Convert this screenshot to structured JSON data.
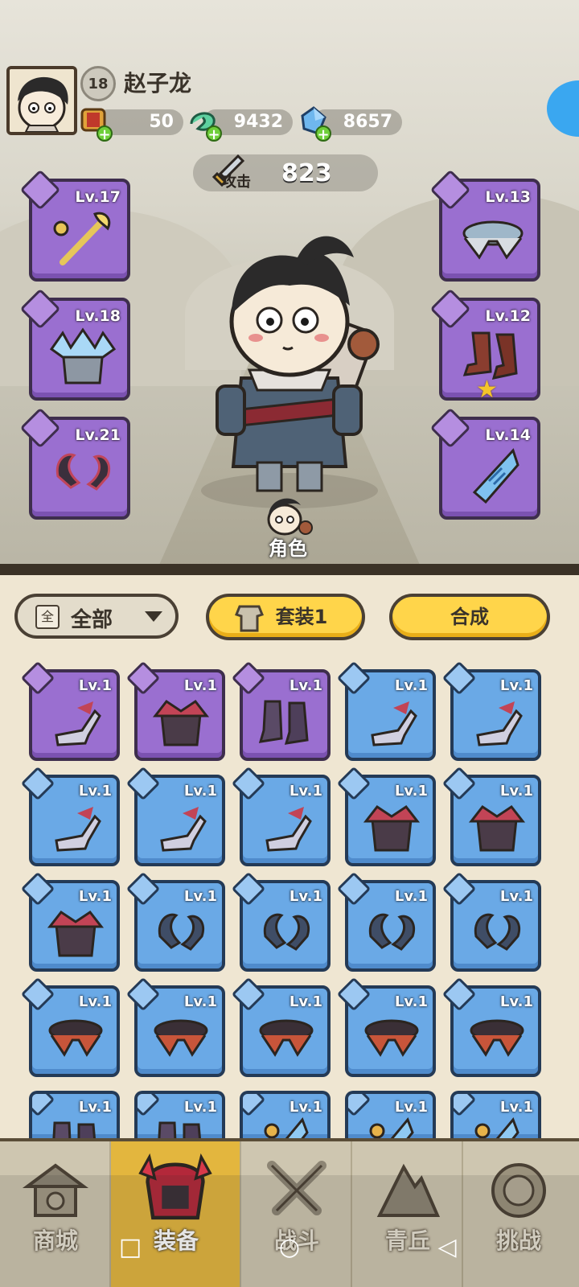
{
  "player": {
    "level": "18",
    "name": "赵子龙"
  },
  "resources": [
    {
      "name": "scroll-icon",
      "value": "50"
    },
    {
      "name": "jade-coin-icon",
      "value": "9432"
    },
    {
      "name": "crystal-icon",
      "value": "8657"
    }
  ],
  "attack": {
    "label": "攻击",
    "value": "823"
  },
  "equipped": {
    "left": [
      {
        "slot": "weapon",
        "level": "Lv.17"
      },
      {
        "slot": "armor",
        "level": "Lv.18"
      },
      {
        "slot": "ring",
        "level": "Lv.21"
      }
    ],
    "right": [
      {
        "slot": "belt",
        "level": "Lv.13"
      },
      {
        "slot": "boots",
        "level": "Lv.12"
      },
      {
        "slot": "amulet",
        "level": "Lv.14"
      }
    ]
  },
  "role_label": "角色",
  "filter": {
    "icon_char": "全",
    "label": "全部"
  },
  "buttons": {
    "set": "套装1",
    "synthesize": "合成"
  },
  "inventory": [
    {
      "rarity": "purple",
      "type": "weapon",
      "level": "Lv.1"
    },
    {
      "rarity": "purple",
      "type": "armor",
      "level": "Lv.1"
    },
    {
      "rarity": "purple",
      "type": "boots",
      "level": "Lv.1"
    },
    {
      "rarity": "blue",
      "type": "weapon",
      "level": "Lv.1"
    },
    {
      "rarity": "blue",
      "type": "weapon",
      "level": "Lv.1"
    },
    {
      "rarity": "blue",
      "type": "weapon",
      "level": "Lv.1"
    },
    {
      "rarity": "blue",
      "type": "weapon",
      "level": "Lv.1"
    },
    {
      "rarity": "blue",
      "type": "weapon",
      "level": "Lv.1"
    },
    {
      "rarity": "blue",
      "type": "armor",
      "level": "Lv.1"
    },
    {
      "rarity": "blue",
      "type": "armor",
      "level": "Lv.1"
    },
    {
      "rarity": "blue",
      "type": "armor",
      "level": "Lv.1"
    },
    {
      "rarity": "blue",
      "type": "ring",
      "level": "Lv.1"
    },
    {
      "rarity": "blue",
      "type": "ring",
      "level": "Lv.1"
    },
    {
      "rarity": "blue",
      "type": "ring",
      "level": "Lv.1"
    },
    {
      "rarity": "blue",
      "type": "ring",
      "level": "Lv.1"
    },
    {
      "rarity": "blue",
      "type": "belt",
      "level": "Lv.1"
    },
    {
      "rarity": "blue",
      "type": "belt",
      "level": "Lv.1"
    },
    {
      "rarity": "blue",
      "type": "belt",
      "level": "Lv.1"
    },
    {
      "rarity": "blue",
      "type": "belt",
      "level": "Lv.1"
    },
    {
      "rarity": "blue",
      "type": "belt",
      "level": "Lv.1"
    },
    {
      "rarity": "blue",
      "type": "boots",
      "level": "Lv.1"
    },
    {
      "rarity": "blue",
      "type": "boots",
      "level": "Lv.1"
    },
    {
      "rarity": "blue",
      "type": "amulet",
      "level": "Lv.1"
    },
    {
      "rarity": "blue",
      "type": "amulet",
      "level": "Lv.1"
    },
    {
      "rarity": "blue",
      "type": "amulet",
      "level": "Lv.1"
    }
  ],
  "nav": [
    {
      "label": "商城",
      "icon": "shop-icon",
      "active": false
    },
    {
      "label": "装备",
      "icon": "equipment-helmet-icon",
      "active": true
    },
    {
      "label": "战斗",
      "icon": "crossed-swords-icon",
      "active": false
    },
    {
      "label": "青丘",
      "icon": "mountain-icon",
      "active": false
    },
    {
      "label": "挑战",
      "icon": "challenge-icon",
      "active": false
    }
  ],
  "colors": {
    "purple_tile": "#9a6fd0",
    "blue_tile": "#6aa9e6",
    "yellow_button": "#ffd54a",
    "nav_active": "#e3b63e"
  }
}
